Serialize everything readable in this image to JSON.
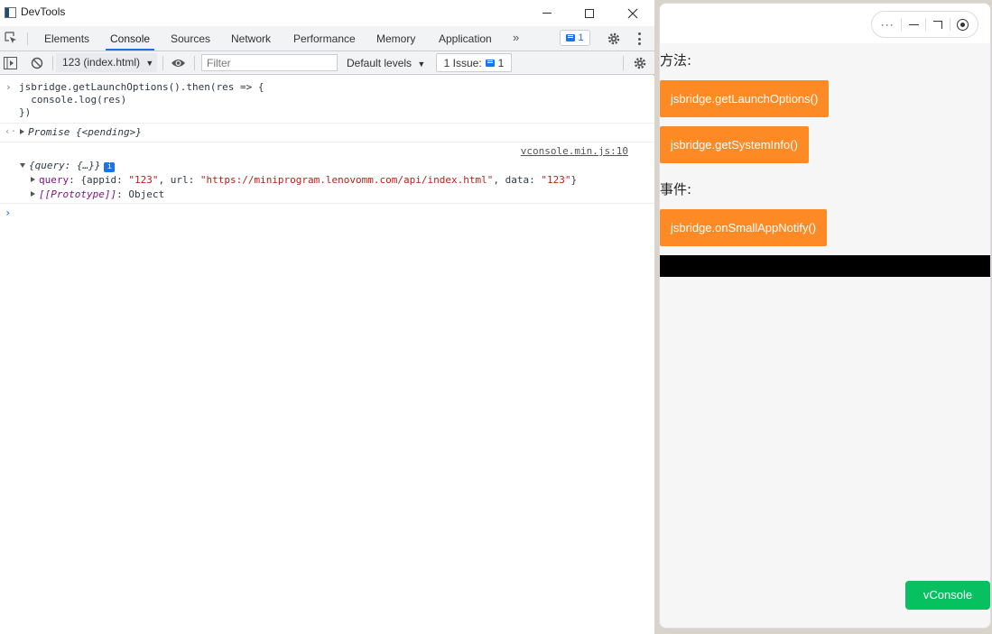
{
  "window": {
    "title": "DevTools"
  },
  "tabs": [
    "Elements",
    "Console",
    "Sources",
    "Network",
    "Performance",
    "Memory",
    "Application"
  ],
  "active_tab": "Console",
  "more_tabs": "»",
  "message_badge": "1",
  "toolbar": {
    "context": "123 (index.html)",
    "filter_placeholder": "Filter",
    "levels": "Default levels",
    "issue_label": "1 Issue:",
    "issue_count": "1"
  },
  "console": {
    "input_line1": "jsbridge.getLaunchOptions().then(res => {",
    "input_line2": "  console.log(res)",
    "input_line3": "})",
    "result": "Promise {<pending>}",
    "source": "vconsole.min.js:10",
    "log_object": "{query: {…}}",
    "query_key": "query",
    "query_prefix": ": {appid: ",
    "appid": "\"123\"",
    "url_label": ", url: ",
    "url": "\"https://miniprogram.lenovomm.com/api/index.html\"",
    "data_label": ", data: ",
    "data_value": "\"123\"",
    "query_suffix": "}",
    "prototype": "[[Prototype]]",
    "prototype_value": ": Object"
  },
  "simulator": {
    "methods_label": "方法:",
    "btn_launch": "jsbridge.getLaunchOptions()",
    "btn_system": "jsbridge.getSystemInfo()",
    "events_label": "事件:",
    "btn_notify": "jsbridge.onSmallAppNotify()",
    "vconsole": "vConsole",
    "capsule_dots": "···"
  },
  "colors": {
    "accent": "#1a73e8",
    "button_orange": "#fd8a25",
    "vconsole_green": "#07c160",
    "string_red": "#c41a16",
    "keyword_purple": "#881280"
  }
}
